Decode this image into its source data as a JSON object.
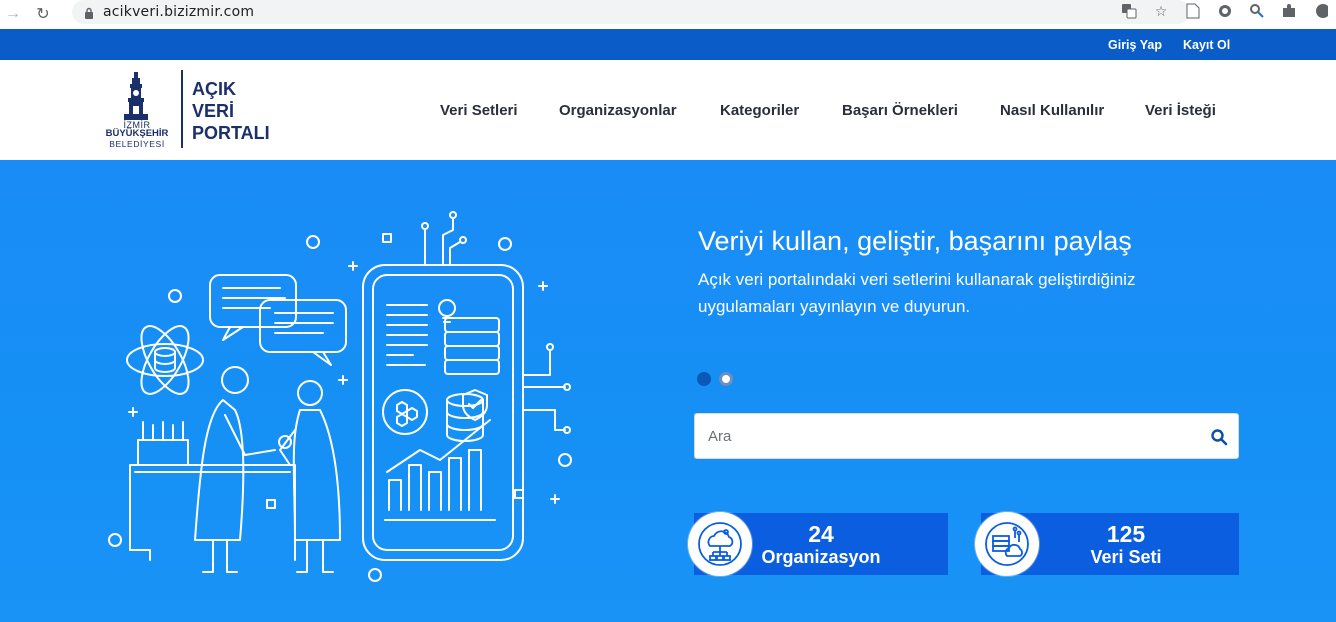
{
  "browser": {
    "url": "acikveri.bizizmir.com"
  },
  "topbar": {
    "login_label": "Giriş Yap",
    "register_label": "Kayıt Ol"
  },
  "logo": {
    "line1": "İZMİR",
    "line2": "BÜYÜKŞEHİR",
    "line3": "BELEDİYESİ",
    "portal_line1": "AÇIK",
    "portal_line2": "VERİ",
    "portal_line3": "PORTALI"
  },
  "nav": {
    "items": [
      {
        "label": "Veri Setleri"
      },
      {
        "label": "Organizasyonlar"
      },
      {
        "label": "Kategoriler"
      },
      {
        "label": "Başarı Örnekleri"
      },
      {
        "label": "Nasıl Kullanılır"
      },
      {
        "label": "Veri İsteği"
      }
    ]
  },
  "hero": {
    "title": "Veriyi kullan, geliştir, başarını paylaş",
    "subtitle": "Açık veri portalındaki veri setlerini kullanarak geliştirdiğiniz uygulamaları yayınlayın ve duyurun.",
    "slides_total": 2,
    "slide_active": 1
  },
  "search": {
    "placeholder": "Ara"
  },
  "stats": [
    {
      "value": "24",
      "label": "Organizasyon",
      "icon": "network-cloud-icon"
    },
    {
      "value": "125",
      "label": "Veri Seti",
      "icon": "server-cloud-icon"
    }
  ],
  "colors": {
    "topbar": "#0a5dc8",
    "hero": "#1a8cf6",
    "stat_box": "#0b5ee0",
    "logo": "#1b2f6b"
  }
}
